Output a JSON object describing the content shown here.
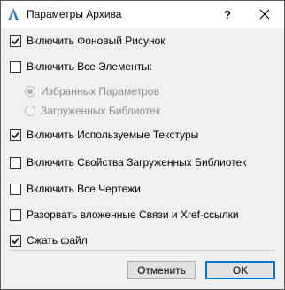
{
  "window": {
    "title": "Параметры Архива",
    "help_label": "?",
    "close_label": "✕",
    "app_icon": "archicad-icon"
  },
  "options": {
    "background_image": {
      "label": "Включить Фоновый Рисунок",
      "checked": true
    },
    "all_elements": {
      "label": "Включить Все Элементы:",
      "checked": false
    },
    "radio_selected_params": {
      "label": "Избранных Параметров",
      "selected": true,
      "enabled": false
    },
    "radio_loaded_libs": {
      "label": "Загруженных Библиотек",
      "selected": false,
      "enabled": false
    },
    "used_textures": {
      "label": "Включить Используемые Текстуры",
      "checked": true
    },
    "library_props": {
      "label": "Включить Свойства Загруженных Библиотек",
      "checked": false
    },
    "all_drawings": {
      "label": "Включить Все Чертежи",
      "checked": false
    },
    "break_links": {
      "label": "Разорвать вложенные Связи и Xref-ссылки",
      "checked": false
    },
    "compress_file": {
      "label": "Сжать файл",
      "checked": true
    }
  },
  "buttons": {
    "cancel_label": "Отменить",
    "ok_label": "OK"
  },
  "colors": {
    "dialog_bg": "#f0f0f0",
    "titlebar_bg": "#ffffff",
    "accent": "#0078d7",
    "disabled_text": "#8c8c8c"
  }
}
